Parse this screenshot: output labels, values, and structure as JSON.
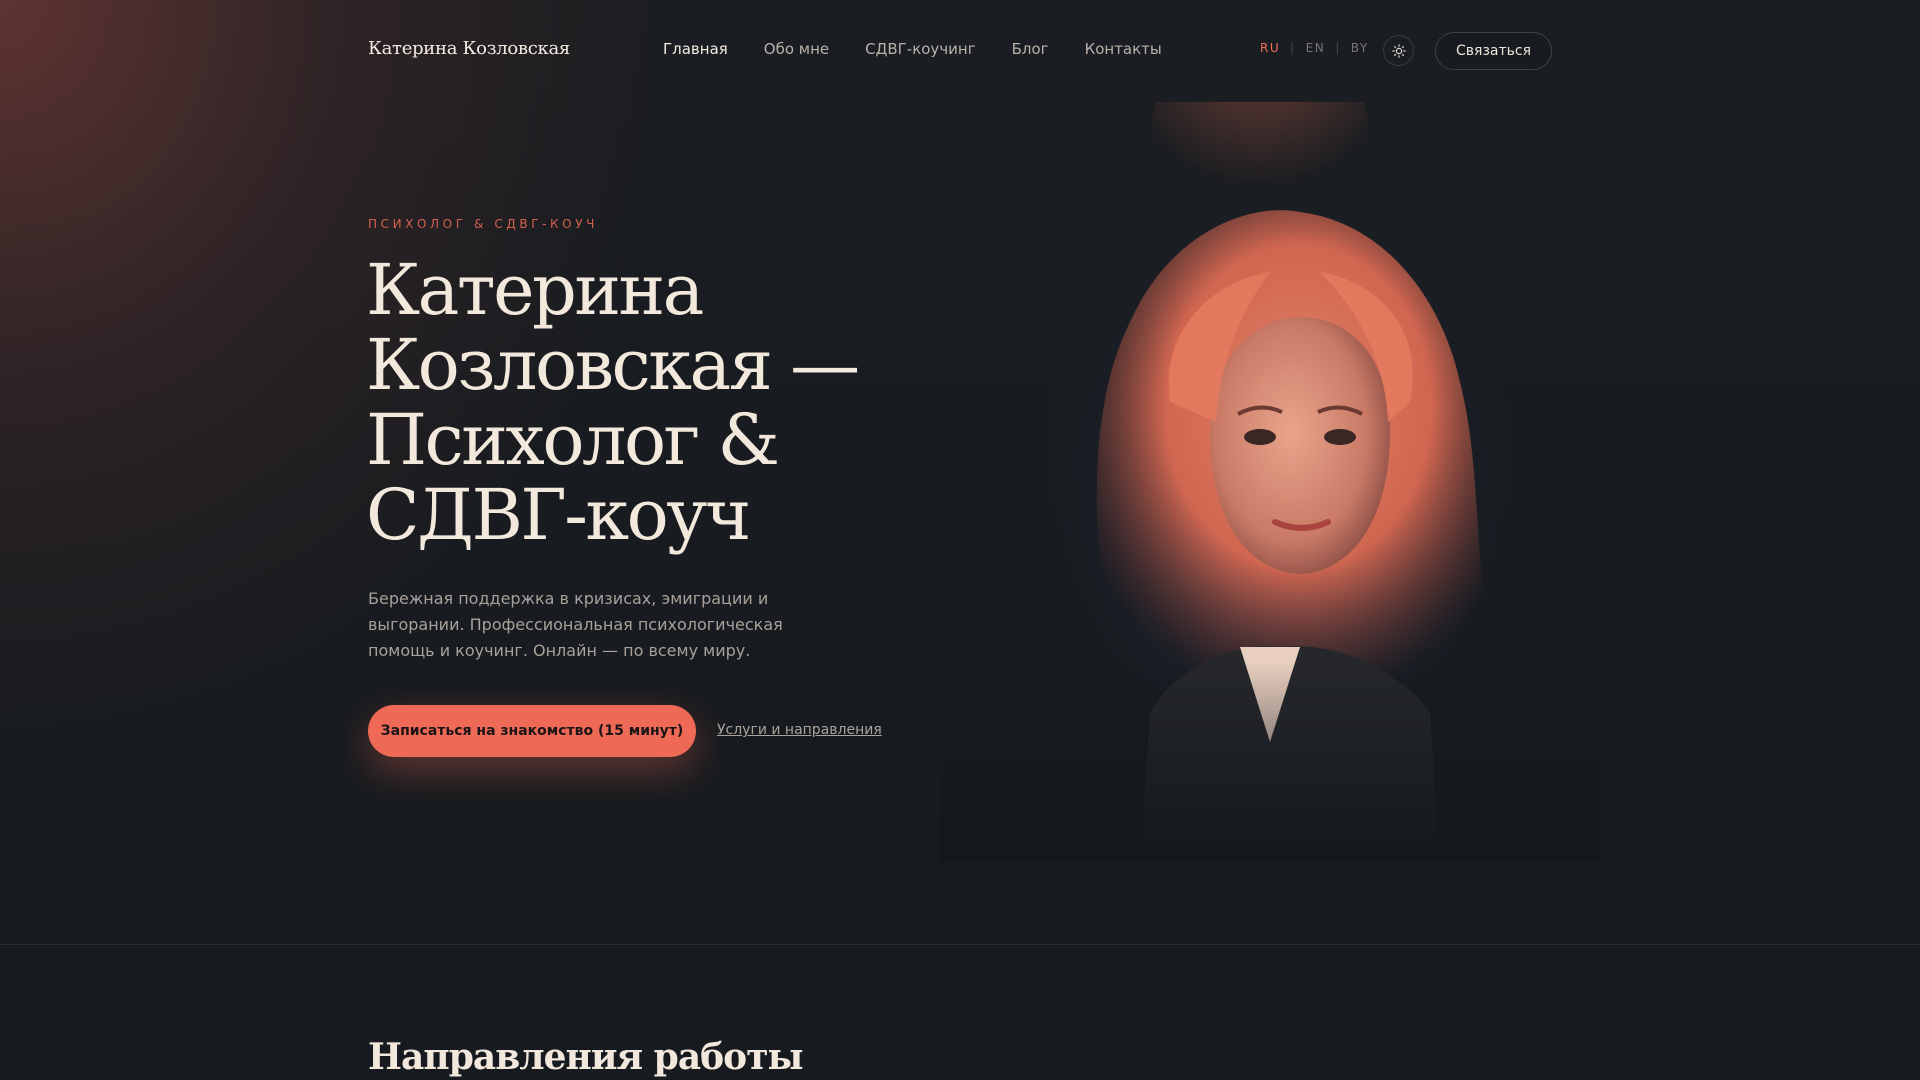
{
  "header": {
    "brand": "Катерина Козловская",
    "nav": [
      "Главная",
      "Обо мне",
      "СДВГ-коучинг",
      "Блог",
      "Контакты"
    ],
    "languages": [
      "RU",
      "EN",
      "BY"
    ],
    "active_language": "RU",
    "theme_icon": "sun-icon",
    "contact_label": "Связаться"
  },
  "hero": {
    "eyebrow": "ПСИХОЛОГ & СДВГ-КОУЧ",
    "title_lines": [
      "Катерина",
      "Козловская —",
      "Психолог &",
      "СДВГ-коуч"
    ],
    "subtitle": "Бережная поддержка в кризисах, эмиграции и выгорании. Профессиональная психологическая помощь и коучинг. Онлайн — по всему миру.",
    "cta_primary": "Записаться на знакомство (15 минут)",
    "cta_secondary": "Услуги и направления"
  },
  "section": {
    "title": "Направления работы"
  },
  "colors": {
    "accent": "#ee6a57",
    "eyebrow": "#d4604f",
    "background": "#14181c",
    "heading": "#f3e8dc"
  }
}
